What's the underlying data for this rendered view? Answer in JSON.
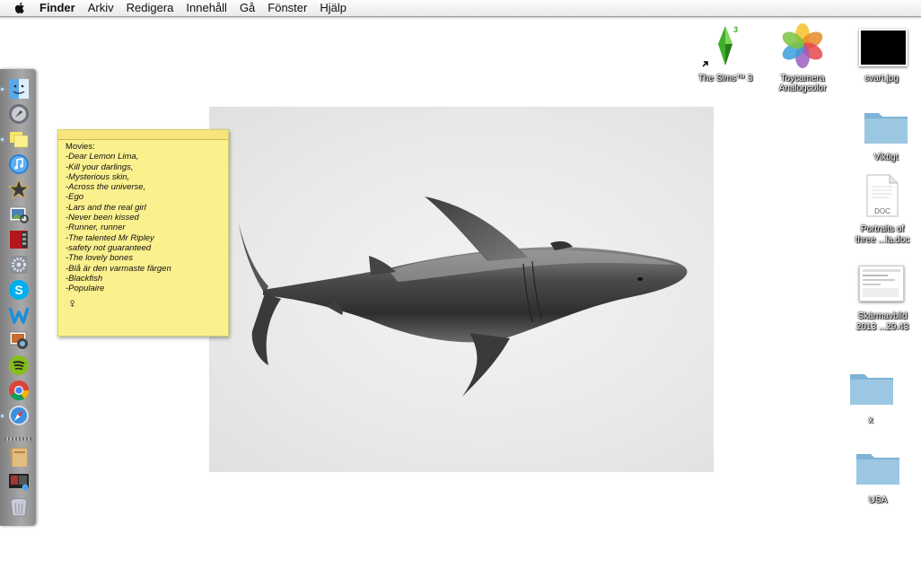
{
  "menubar": {
    "app_name": "Finder",
    "items": [
      "Arkiv",
      "Redigera",
      "Innehåll",
      "Gå",
      "Fönster",
      "Hjälp"
    ]
  },
  "dock": {
    "apps": [
      {
        "name": "finder-icon"
      },
      {
        "name": "launchpad-icon"
      },
      {
        "name": "stickies-icon"
      },
      {
        "name": "itunes-icon"
      },
      {
        "name": "imovie-icon"
      },
      {
        "name": "preview-icon"
      },
      {
        "name": "photo-booth-icon"
      },
      {
        "name": "system-preferences-icon"
      },
      {
        "name": "skype-icon"
      },
      {
        "name": "wunderlist-icon"
      },
      {
        "name": "iphoto-icon"
      },
      {
        "name": "spotify-icon"
      },
      {
        "name": "chrome-icon"
      },
      {
        "name": "safari-icon"
      },
      {
        "name": "documents-stack-icon"
      },
      {
        "name": "screenshots-stack-icon"
      },
      {
        "name": "trash-icon"
      }
    ]
  },
  "sticky": {
    "title": "Movies:",
    "lines": [
      "-Dear Lemon Lima,",
      "-Kill your darlings,",
      "-Mysterious skin,",
      "-Across the universe,",
      "-Ego",
      "-Lars and the real girl",
      "-Never been kissed",
      "-Runner, runner",
      "-The talented Mr Ripley",
      "-safety not guaranteed",
      "-The lovely bones",
      "-Blå är den varmaste färgen",
      "-Blackfish",
      "-Populaire"
    ],
    "symbol": "♀"
  },
  "desktop": {
    "sims_label": "The Sims™ 3",
    "toycamera_label_1": "Toycamera",
    "toycamera_label_2": "Analogcolor",
    "svart_label": "svart.jpg",
    "viktigt_label": "Viktigt",
    "doc_badge": "DOC",
    "doc_label_1": "Portraits of",
    "doc_label_2": "three ...la.doc",
    "screenshot_label_1": "Skärmavbild",
    "screenshot_label_2": "2013 ...29.43",
    "x_label": "x",
    "usa_label": "USA"
  },
  "colors": {
    "sticky_yellow": "#fbf08e",
    "folder_blue": "#9cc7e3"
  }
}
